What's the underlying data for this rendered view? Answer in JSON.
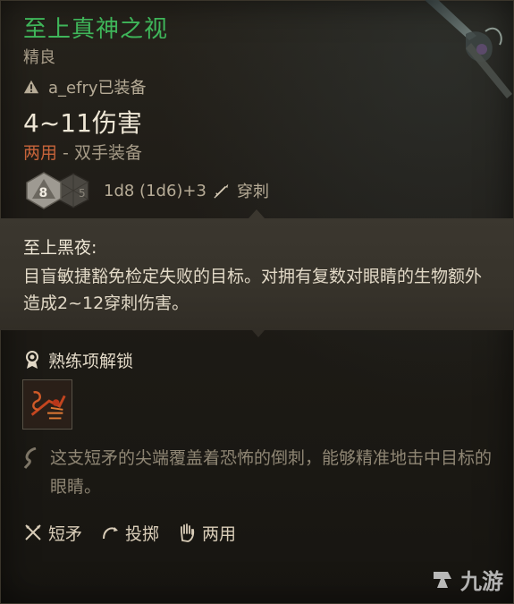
{
  "item": {
    "name": "至上真神之视",
    "rarity": "精良",
    "equipped_by": "a_efry已装备",
    "damage": "4~11伤害",
    "handedness_main": "两用",
    "handedness_sep": " - ",
    "handedness_sub": "双手装备",
    "dice_main": "8",
    "dice_formula": "1d8 (1d6)+3",
    "damage_type": "穿刺"
  },
  "special": {
    "title": "至上黑夜:",
    "desc": "目盲敏捷豁免检定失败的目标。对拥有复数对眼睛的生物额外造成2~12穿刺伤害。"
  },
  "proficiency": {
    "label": "熟练项解锁"
  },
  "flavor": {
    "text": "这支短矛的尖端覆盖着恐怖的倒刺，能够精准地击中目标的眼睛。"
  },
  "properties": [
    {
      "label": "短矛",
      "icon": "crossed-spears-icon"
    },
    {
      "label": "投掷",
      "icon": "throw-arc-icon"
    },
    {
      "label": "两用",
      "icon": "hand-icon"
    }
  ],
  "watermark": {
    "text": "九游"
  },
  "colors": {
    "title": "#3fb65a",
    "accent": "#c7643a",
    "flavor": "#8f8674"
  }
}
